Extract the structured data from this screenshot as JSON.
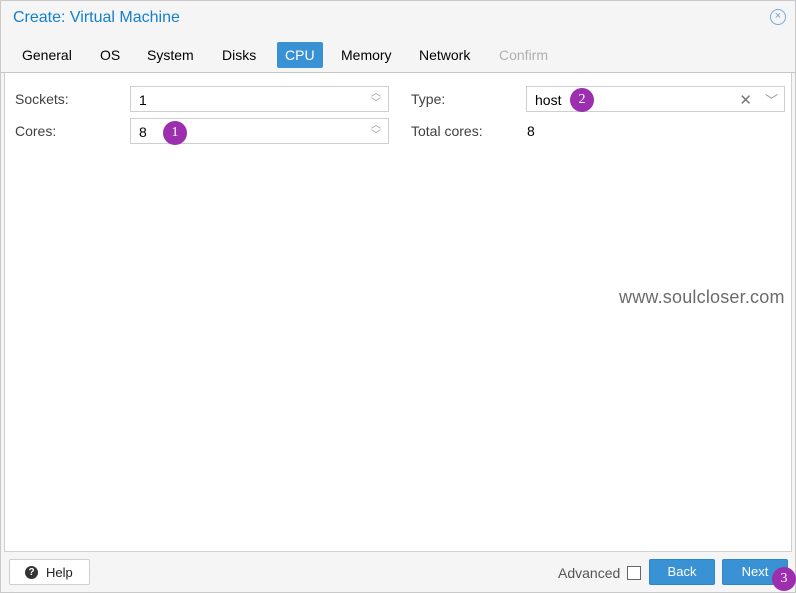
{
  "window": {
    "title": "Create: Virtual Machine",
    "close_icon": "×"
  },
  "tabs": [
    {
      "label": "General",
      "state": "normal"
    },
    {
      "label": "OS",
      "state": "normal"
    },
    {
      "label": "System",
      "state": "normal"
    },
    {
      "label": "Disks",
      "state": "normal"
    },
    {
      "label": "CPU",
      "state": "active"
    },
    {
      "label": "Memory",
      "state": "normal"
    },
    {
      "label": "Network",
      "state": "normal"
    },
    {
      "label": "Confirm",
      "state": "disabled"
    }
  ],
  "form": {
    "sockets_label": "Sockets:",
    "sockets_value": "1",
    "cores_label": "Cores:",
    "cores_value": "8",
    "type_label": "Type:",
    "type_value": "host",
    "total_cores_label": "Total cores:",
    "total_cores_value": "8"
  },
  "annotations": {
    "step1": "1",
    "step2": "2",
    "step3": "3"
  },
  "watermark": "www.soulcloser.com",
  "footer": {
    "help_label": "Help",
    "help_icon": "?",
    "advanced_label": "Advanced",
    "back_label": "Back",
    "next_label": "Next"
  },
  "colors": {
    "accent": "#3892d4",
    "title": "#157fcc",
    "annotation": "#9b2fae"
  }
}
